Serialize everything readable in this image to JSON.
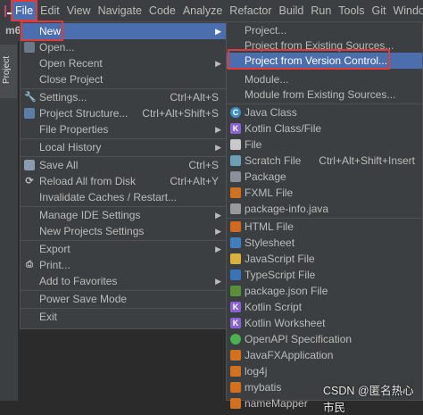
{
  "menubar": {
    "items": [
      "File",
      "Edit",
      "View",
      "Navigate",
      "Code",
      "Analyze",
      "Refactor",
      "Build",
      "Run",
      "Tools",
      "Git",
      "Window"
    ]
  },
  "project_label": "m6",
  "toolwindow": {
    "tab_label": "Project"
  },
  "file_menu": {
    "items": [
      {
        "label": "New",
        "shortcut": "",
        "arrow": true
      },
      {
        "label": "Open...",
        "shortcut": "",
        "arrow": false
      },
      {
        "label": "Open Recent",
        "shortcut": "",
        "arrow": true
      },
      {
        "label": "Close Project",
        "shortcut": "",
        "arrow": false
      },
      {
        "label": "Settings...",
        "shortcut": "Ctrl+Alt+S",
        "arrow": false
      },
      {
        "label": "Project Structure...",
        "shortcut": "Ctrl+Alt+Shift+S",
        "arrow": false
      },
      {
        "label": "File Properties",
        "shortcut": "",
        "arrow": true
      },
      {
        "label": "Local History",
        "shortcut": "",
        "arrow": true
      },
      {
        "label": "Save All",
        "shortcut": "Ctrl+S",
        "arrow": false
      },
      {
        "label": "Reload All from Disk",
        "shortcut": "Ctrl+Alt+Y",
        "arrow": false
      },
      {
        "label": "Invalidate Caches / Restart...",
        "shortcut": "",
        "arrow": false
      },
      {
        "label": "Manage IDE Settings",
        "shortcut": "",
        "arrow": true
      },
      {
        "label": "New Projects Settings",
        "shortcut": "",
        "arrow": true
      },
      {
        "label": "Export",
        "shortcut": "",
        "arrow": true
      },
      {
        "label": "Print...",
        "shortcut": "",
        "arrow": false
      },
      {
        "label": "Add to Favorites",
        "shortcut": "",
        "arrow": true
      },
      {
        "label": "Power Save Mode",
        "shortcut": "",
        "arrow": false
      },
      {
        "label": "Exit",
        "shortcut": "",
        "arrow": false
      }
    ]
  },
  "new_menu": {
    "items": [
      {
        "label": "Project...",
        "shortcut": ""
      },
      {
        "label": "Project from Existing Sources...",
        "shortcut": ""
      },
      {
        "label": "Project from Version Control...",
        "shortcut": ""
      },
      {
        "label": "Module...",
        "shortcut": ""
      },
      {
        "label": "Module from Existing Sources...",
        "shortcut": ""
      },
      {
        "label": "Java Class",
        "shortcut": ""
      },
      {
        "label": "Kotlin Class/File",
        "shortcut": ""
      },
      {
        "label": "File",
        "shortcut": ""
      },
      {
        "label": "Scratch File",
        "shortcut": "Ctrl+Alt+Shift+Insert"
      },
      {
        "label": "Package",
        "shortcut": ""
      },
      {
        "label": "FXML File",
        "shortcut": ""
      },
      {
        "label": "package-info.java",
        "shortcut": ""
      },
      {
        "label": "HTML File",
        "shortcut": ""
      },
      {
        "label": "Stylesheet",
        "shortcut": ""
      },
      {
        "label": "JavaScript File",
        "shortcut": ""
      },
      {
        "label": "TypeScript File",
        "shortcut": ""
      },
      {
        "label": "package.json File",
        "shortcut": ""
      },
      {
        "label": "Kotlin Script",
        "shortcut": ""
      },
      {
        "label": "Kotlin Worksheet",
        "shortcut": ""
      },
      {
        "label": "OpenAPI Specification",
        "shortcut": ""
      },
      {
        "label": "JavaFXApplication",
        "shortcut": ""
      },
      {
        "label": "log4j",
        "shortcut": ""
      },
      {
        "label": "mybatis",
        "shortcut": ""
      },
      {
        "label": "nameMapper",
        "shortcut": ""
      }
    ]
  },
  "watermark": "CSDN @匿名热心市民"
}
